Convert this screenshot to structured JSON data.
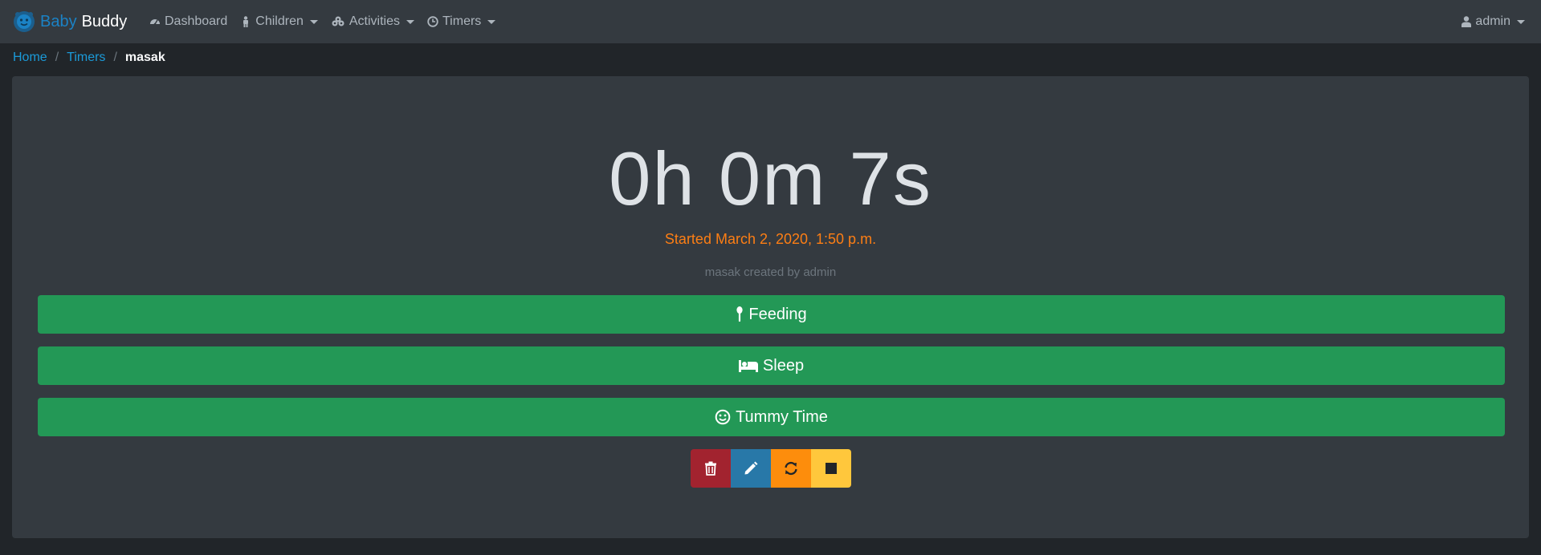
{
  "brand": {
    "name_first": "Baby",
    "name_second": "Buddy",
    "accent_color": "#1b82c5"
  },
  "navbar": {
    "items": [
      {
        "label": "Dashboard",
        "icon": "dashboard-icon"
      },
      {
        "label": "Children",
        "icon": "child-icon",
        "dropdown": true
      },
      {
        "label": "Activities",
        "icon": "activities-icon",
        "dropdown": true
      },
      {
        "label": "Timers",
        "icon": "clock-icon",
        "dropdown": true
      }
    ],
    "user": {
      "label": "admin",
      "icon": "user-icon",
      "dropdown": true
    }
  },
  "breadcrumb": {
    "items": [
      {
        "label": "Home",
        "link": true
      },
      {
        "label": "Timers",
        "link": true
      },
      {
        "label": "masak",
        "link": false
      }
    ],
    "separator": "/"
  },
  "timer": {
    "elapsed": "0h 0m 7s",
    "started": "Started March 2, 2020, 1:50 p.m.",
    "created_by": "masak created by admin"
  },
  "actions": {
    "feeding": "Feeding",
    "sleep": "Sleep",
    "tummy_time": "Tummy Time"
  },
  "controls": [
    {
      "name": "delete-button",
      "icon": "trash-icon",
      "color": "#a2232f"
    },
    {
      "name": "edit-button",
      "icon": "pencil-icon",
      "color": "#2878a8"
    },
    {
      "name": "restart-button",
      "icon": "refresh-icon",
      "color": "#fd8d0c"
    },
    {
      "name": "stop-button",
      "icon": "stop-icon",
      "color": "#ffc73c"
    }
  ],
  "colors": {
    "background": "#212529",
    "surface": "#343a40",
    "success": "#239856",
    "link": "#1b9ad8",
    "orange": "#fd7e14"
  }
}
